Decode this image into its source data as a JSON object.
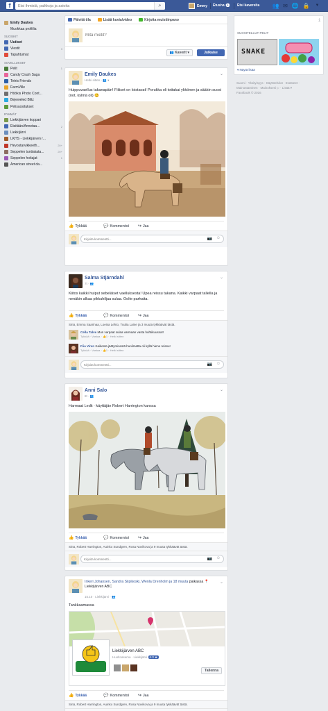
{
  "topbar": {
    "search_placeholder": "Etsi ihmisiä, paikkoja ja asioita",
    "user_name": "Emmy",
    "home_label": "Etusivu",
    "home_badge": "1",
    "find_friends_label": "Etsi kavereita"
  },
  "leftnav": {
    "profile_name": "Emily Daukes",
    "edit_profile": "Muokkaa profiilia",
    "favorites_head": "SUOSIKIT",
    "favorites": [
      {
        "label": "Uutiset",
        "count": "",
        "color": "#4267b2"
      },
      {
        "label": "Viestit",
        "count": "3",
        "color": "#4267b2"
      },
      {
        "label": "Tapahtumat",
        "count": "",
        "color": "#e04c3c"
      }
    ],
    "apps_head": "SOVELLUKSET",
    "apps": [
      {
        "label": "Pelit",
        "count": "1",
        "color": "#4a7c3a"
      },
      {
        "label": "Candy Crush Saga",
        "count": "",
        "color": "#e8679b"
      },
      {
        "label": "Tetris Friends",
        "count": "",
        "color": "#2c5fa8"
      },
      {
        "label": "FarmVille",
        "count": "",
        "color": "#e9a52b"
      },
      {
        "label": "Höökis Photo Cont...",
        "count": "",
        "color": "#6f6f6f"
      },
      {
        "label": "Bejeweled Blitz",
        "count": "",
        "color": "#2baadf"
      },
      {
        "label": "Pelisuositukset",
        "count": "",
        "color": "#5d9a3c"
      }
    ],
    "groups_head": "RYHMÄT",
    "groups": [
      {
        "label": "Liekkijärven koppari",
        "count": "",
        "color": "#7a9a4b"
      },
      {
        "label": "Etsitään/Annetaa...",
        "count": "2",
        "color": "#4267b2"
      },
      {
        "label": "Liekkijärvi",
        "count": "",
        "color": "#6c8fbe"
      },
      {
        "label": "LKHS - Liekkijärven r...",
        "count": "",
        "color": "#a35d2a"
      },
      {
        "label": "Hevostarvikkeeth...",
        "count": "20+",
        "color": "#c0392b"
      },
      {
        "label": "Seppelen tuntiakata...",
        "count": "20+",
        "color": "#8d6e63"
      },
      {
        "label": "Seppelen hoitajat",
        "count": "1",
        "color": "#9b59b6"
      },
      {
        "label": "American street da...",
        "count": "",
        "color": "#555555"
      }
    ]
  },
  "composer": {
    "tabs": [
      "Päivitä tila",
      "Lisää kuvia/video",
      "Kirjoita muistiinpano"
    ],
    "placeholder": "Mitä mietit?",
    "audience": "Kaverit ▾",
    "post_label": "Julkaise"
  },
  "actions": {
    "like": "Tykkää",
    "comment": "Kommentoi",
    "share": "Jaa"
  },
  "comment_placeholder": "Kirjoita kommentti...",
  "posts": [
    {
      "name": "Emily Daukes",
      "meta": "Hetki sitten · 👥 ▾",
      "text": "Huippuvaellus takanapäin! Fiiliset on loistavat! Porukka oli tottakai ykkönen ja sääkin suosi (not, kylmä oli) 😊"
    },
    {
      "name": "Salma Stjärndahl",
      "meta": "7t · 👥",
      "text": "Kiitos kaikki huiput sebeläiset vaelluksesta! Upea reissu takana. Kaikki varpaat tallella ja nenäkin alkaa pikkuhiljaa sulaa. Oolte parhaita.",
      "likes": "Sinä, Emma Saarinaa, Loeisa Lehto, Tuulia Laine ja 3 muuta tykkäävät tästä.",
      "comments": [
        {
          "name": "Cella Talve",
          "text": "Mun varpaat sulaa varmaan vasta huhtikuussa!!",
          "meta": "Tykkää · Vastaa · 👍1 · Hetki sitten"
        },
        {
          "name": "Fiia Viren",
          "text": "Kaikesta jäätymisestä huolimatta oli kyllä hieno reissu!",
          "meta": "Tykkää · Vastaa · 👍1 · Hetki sitten"
        }
      ]
    },
    {
      "name": "Anni Salo",
      "meta": "8t · 👥",
      "text": "Harmaat Ledit · käyttäjän Robert Harrington kanssa",
      "likes": "Sinä, Robert Harrington, Auinko Sundgren, Rosa Novikova ja 9 muuta tykkäävät tästä."
    },
    {
      "name": "Inkeri Johansen, Sandra Siipikoski, Wenla Drenholm ja 18 muuta",
      "meta": "paikassa 📍 Liekkijärven ABC",
      "meta2": "15.10 · Liekkijärvi · 👥",
      "text": "Tankkaamassa",
      "place_name": "Liekkijärven ABC",
      "place_type": "Huoltoasema · Liekkijärvi",
      "place_rating": "4.3 ★",
      "follow_label": "Tallenna",
      "likes": "Sinä, Robert Harrington, Auinko Sundgren, Rosa Novikova ja 9 muuta tykkäävät tästä."
    }
  ],
  "right": {
    "games_head": "SUOSITELLUT PELIT",
    "game1": "SNAKE",
    "more": "▾ Näytä lisää",
    "footer": "Suomi · Yksityisyys · Käyttöehdot · Evästeet · Mainostaminen · Mainoksesi ▷ · Lisää ▾",
    "copyright": "Facebook © 2016"
  }
}
